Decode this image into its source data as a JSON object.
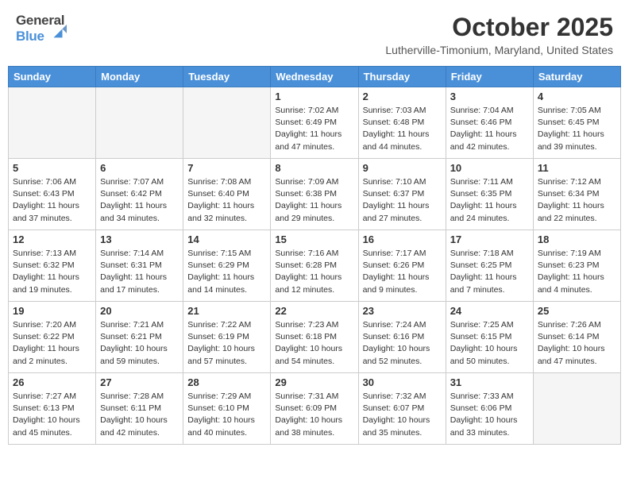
{
  "header": {
    "logo_general": "General",
    "logo_blue": "Blue",
    "month_title": "October 2025",
    "location": "Lutherville-Timonium, Maryland, United States"
  },
  "days_of_week": [
    "Sunday",
    "Monday",
    "Tuesday",
    "Wednesday",
    "Thursday",
    "Friday",
    "Saturday"
  ],
  "weeks": [
    [
      {
        "day": "",
        "info": "",
        "empty": true
      },
      {
        "day": "",
        "info": "",
        "empty": true
      },
      {
        "day": "",
        "info": "",
        "empty": true
      },
      {
        "day": "1",
        "info": "Sunrise: 7:02 AM\nSunset: 6:49 PM\nDaylight: 11 hours\nand 47 minutes.",
        "empty": false
      },
      {
        "day": "2",
        "info": "Sunrise: 7:03 AM\nSunset: 6:48 PM\nDaylight: 11 hours\nand 44 minutes.",
        "empty": false
      },
      {
        "day": "3",
        "info": "Sunrise: 7:04 AM\nSunset: 6:46 PM\nDaylight: 11 hours\nand 42 minutes.",
        "empty": false
      },
      {
        "day": "4",
        "info": "Sunrise: 7:05 AM\nSunset: 6:45 PM\nDaylight: 11 hours\nand 39 minutes.",
        "empty": false
      }
    ],
    [
      {
        "day": "5",
        "info": "Sunrise: 7:06 AM\nSunset: 6:43 PM\nDaylight: 11 hours\nand 37 minutes.",
        "empty": false
      },
      {
        "day": "6",
        "info": "Sunrise: 7:07 AM\nSunset: 6:42 PM\nDaylight: 11 hours\nand 34 minutes.",
        "empty": false
      },
      {
        "day": "7",
        "info": "Sunrise: 7:08 AM\nSunset: 6:40 PM\nDaylight: 11 hours\nand 32 minutes.",
        "empty": false
      },
      {
        "day": "8",
        "info": "Sunrise: 7:09 AM\nSunset: 6:38 PM\nDaylight: 11 hours\nand 29 minutes.",
        "empty": false
      },
      {
        "day": "9",
        "info": "Sunrise: 7:10 AM\nSunset: 6:37 PM\nDaylight: 11 hours\nand 27 minutes.",
        "empty": false
      },
      {
        "day": "10",
        "info": "Sunrise: 7:11 AM\nSunset: 6:35 PM\nDaylight: 11 hours\nand 24 minutes.",
        "empty": false
      },
      {
        "day": "11",
        "info": "Sunrise: 7:12 AM\nSunset: 6:34 PM\nDaylight: 11 hours\nand 22 minutes.",
        "empty": false
      }
    ],
    [
      {
        "day": "12",
        "info": "Sunrise: 7:13 AM\nSunset: 6:32 PM\nDaylight: 11 hours\nand 19 minutes.",
        "empty": false
      },
      {
        "day": "13",
        "info": "Sunrise: 7:14 AM\nSunset: 6:31 PM\nDaylight: 11 hours\nand 17 minutes.",
        "empty": false
      },
      {
        "day": "14",
        "info": "Sunrise: 7:15 AM\nSunset: 6:29 PM\nDaylight: 11 hours\nand 14 minutes.",
        "empty": false
      },
      {
        "day": "15",
        "info": "Sunrise: 7:16 AM\nSunset: 6:28 PM\nDaylight: 11 hours\nand 12 minutes.",
        "empty": false
      },
      {
        "day": "16",
        "info": "Sunrise: 7:17 AM\nSunset: 6:26 PM\nDaylight: 11 hours\nand 9 minutes.",
        "empty": false
      },
      {
        "day": "17",
        "info": "Sunrise: 7:18 AM\nSunset: 6:25 PM\nDaylight: 11 hours\nand 7 minutes.",
        "empty": false
      },
      {
        "day": "18",
        "info": "Sunrise: 7:19 AM\nSunset: 6:23 PM\nDaylight: 11 hours\nand 4 minutes.",
        "empty": false
      }
    ],
    [
      {
        "day": "19",
        "info": "Sunrise: 7:20 AM\nSunset: 6:22 PM\nDaylight: 11 hours\nand 2 minutes.",
        "empty": false
      },
      {
        "day": "20",
        "info": "Sunrise: 7:21 AM\nSunset: 6:21 PM\nDaylight: 10 hours\nand 59 minutes.",
        "empty": false
      },
      {
        "day": "21",
        "info": "Sunrise: 7:22 AM\nSunset: 6:19 PM\nDaylight: 10 hours\nand 57 minutes.",
        "empty": false
      },
      {
        "day": "22",
        "info": "Sunrise: 7:23 AM\nSunset: 6:18 PM\nDaylight: 10 hours\nand 54 minutes.",
        "empty": false
      },
      {
        "day": "23",
        "info": "Sunrise: 7:24 AM\nSunset: 6:16 PM\nDaylight: 10 hours\nand 52 minutes.",
        "empty": false
      },
      {
        "day": "24",
        "info": "Sunrise: 7:25 AM\nSunset: 6:15 PM\nDaylight: 10 hours\nand 50 minutes.",
        "empty": false
      },
      {
        "day": "25",
        "info": "Sunrise: 7:26 AM\nSunset: 6:14 PM\nDaylight: 10 hours\nand 47 minutes.",
        "empty": false
      }
    ],
    [
      {
        "day": "26",
        "info": "Sunrise: 7:27 AM\nSunset: 6:13 PM\nDaylight: 10 hours\nand 45 minutes.",
        "empty": false
      },
      {
        "day": "27",
        "info": "Sunrise: 7:28 AM\nSunset: 6:11 PM\nDaylight: 10 hours\nand 42 minutes.",
        "empty": false
      },
      {
        "day": "28",
        "info": "Sunrise: 7:29 AM\nSunset: 6:10 PM\nDaylight: 10 hours\nand 40 minutes.",
        "empty": false
      },
      {
        "day": "29",
        "info": "Sunrise: 7:31 AM\nSunset: 6:09 PM\nDaylight: 10 hours\nand 38 minutes.",
        "empty": false
      },
      {
        "day": "30",
        "info": "Sunrise: 7:32 AM\nSunset: 6:07 PM\nDaylight: 10 hours\nand 35 minutes.",
        "empty": false
      },
      {
        "day": "31",
        "info": "Sunrise: 7:33 AM\nSunset: 6:06 PM\nDaylight: 10 hours\nand 33 minutes.",
        "empty": false
      },
      {
        "day": "",
        "info": "",
        "empty": true
      }
    ]
  ]
}
